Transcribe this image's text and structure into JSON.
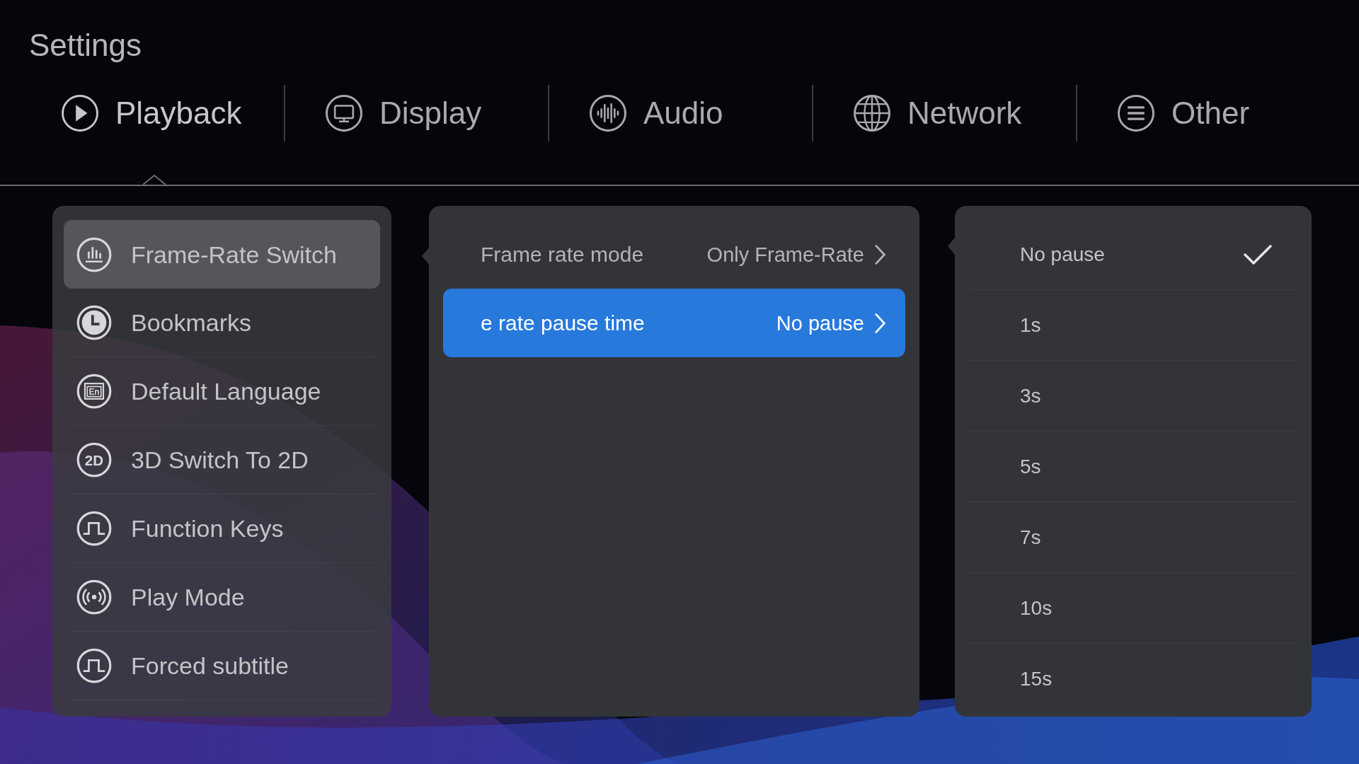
{
  "title": "Settings",
  "tabs": [
    {
      "label": "Playback",
      "selected": true
    },
    {
      "label": "Display",
      "selected": false
    },
    {
      "label": "Audio",
      "selected": false
    },
    {
      "label": "Network",
      "selected": false
    },
    {
      "label": "Other",
      "selected": false
    }
  ],
  "menu": [
    {
      "label": "Frame-Rate Switch",
      "selected": true
    },
    {
      "label": "Bookmarks",
      "selected": false
    },
    {
      "label": "Default Language",
      "selected": false,
      "icon_text": "En"
    },
    {
      "label": "3D Switch To 2D",
      "selected": false,
      "icon_text": "2D"
    },
    {
      "label": "Function Keys",
      "selected": false
    },
    {
      "label": "Play Mode",
      "selected": false
    },
    {
      "label": "Forced subtitle",
      "selected": false
    }
  ],
  "settings": [
    {
      "label": "Frame rate mode",
      "value": "Only Frame-Rate",
      "selected": false
    },
    {
      "label": "e rate pause time",
      "value": "No pause",
      "selected": true
    }
  ],
  "options": [
    {
      "label": "No pause",
      "checked": true
    },
    {
      "label": "1s",
      "checked": false
    },
    {
      "label": "3s",
      "checked": false
    },
    {
      "label": "5s",
      "checked": false
    },
    {
      "label": "7s",
      "checked": false
    },
    {
      "label": "10s",
      "checked": false
    },
    {
      "label": "15s",
      "checked": false
    }
  ]
}
